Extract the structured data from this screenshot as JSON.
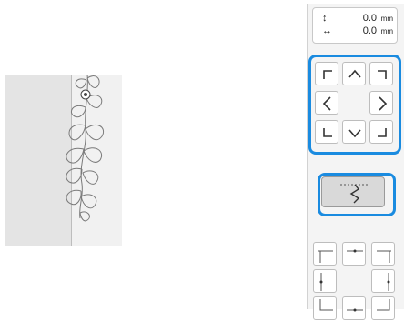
{
  "readout": {
    "vertical": {
      "icon": "vertical-move-icon",
      "value": "0.0",
      "unit": "mm"
    },
    "horizontal": {
      "icon": "horizontal-move-icon",
      "value": "0.0",
      "unit": "mm"
    }
  },
  "accent_color": "#1a8be0",
  "direction_buttons": [
    "move-up-left",
    "move-up",
    "move-up-right",
    "move-left",
    "move-right",
    "move-down-left",
    "move-down",
    "move-down-right"
  ],
  "stitch_button": {
    "icon": "needle-point-stitch-icon"
  },
  "align_buttons": [
    "align-top-left",
    "align-top-center",
    "align-top-right",
    "align-middle-left",
    "align-middle-right",
    "align-bottom-left",
    "align-bottom-center",
    "align-bottom-right"
  ]
}
